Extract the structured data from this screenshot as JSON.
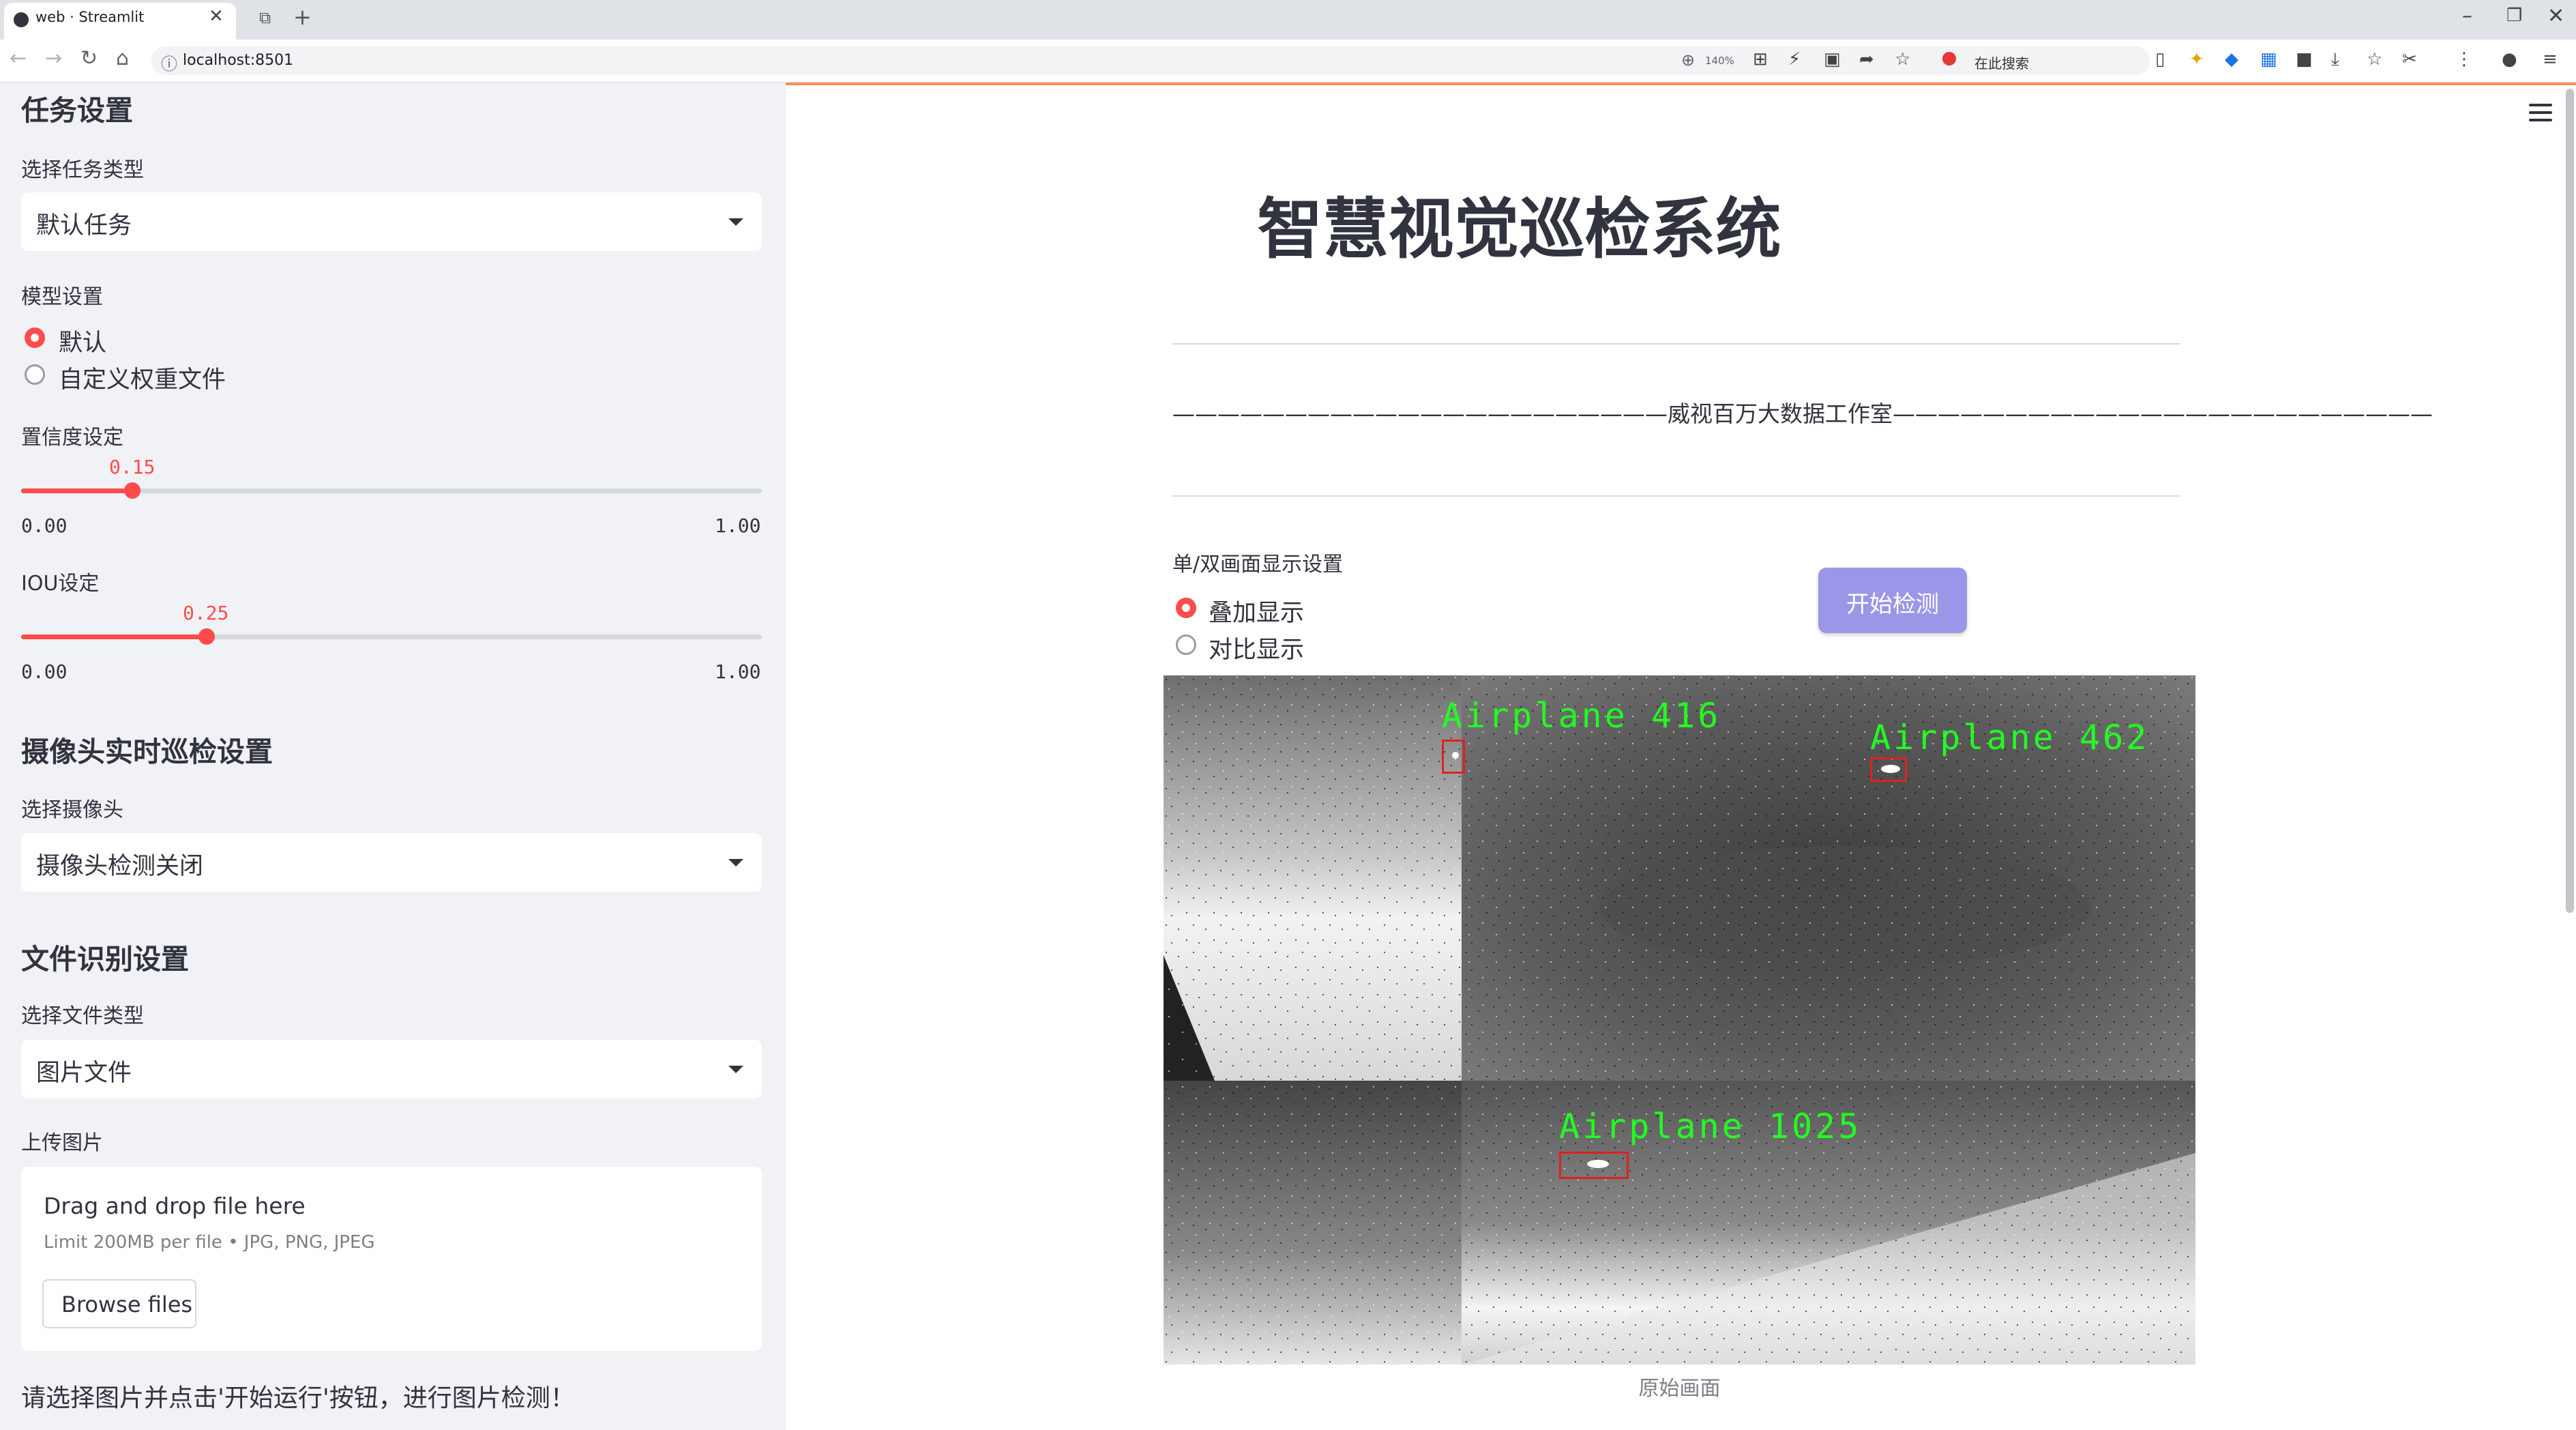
{
  "browser": {
    "tab_title": "web · Streamlit",
    "url": "localhost:8501",
    "zoom": "140%",
    "search_label": "在此搜索"
  },
  "sidebar": {
    "task_section_title": "任务设置",
    "task_type_label": "选择任务类型",
    "task_type_value": "默认任务",
    "model_label": "模型设置",
    "model_options": [
      "默认",
      "自定义权重文件"
    ],
    "model_selected": "默认",
    "confidence": {
      "label": "置信度设定",
      "value": 0.15,
      "value_text": "0.15",
      "min_text": "0.00",
      "max_text": "1.00"
    },
    "iou": {
      "label": "IOU设定",
      "value": 0.25,
      "value_text": "0.25",
      "min_text": "0.00",
      "max_text": "1.00"
    },
    "camera_section_title": "摄像头实时巡检设置",
    "camera_label": "选择摄像头",
    "camera_value": "摄像头检测关闭",
    "file_section_title": "文件识别设置",
    "file_type_label": "选择文件类型",
    "file_type_value": "图片文件",
    "upload_label": "上传图片",
    "upload_title": "Drag and drop file here",
    "upload_limit": "Limit 200MB per file • JPG, PNG, JPEG",
    "browse_label": "Browse files",
    "hint": "请选择图片并点击'开始运行'按钮，进行图片检测！"
  },
  "main": {
    "title": "智慧视觉巡检系统",
    "subtitle": "——————————————————————威视百万大数据工作室————————————————————————",
    "display_label": "单/双画面显示设置",
    "display_options": [
      "叠加显示",
      "对比显示"
    ],
    "display_selected": "叠加显示",
    "start_button": "开始检测",
    "caption": "原始画面",
    "detections": [
      {
        "label": "Airplane  416"
      },
      {
        "label": "Airplane  462"
      },
      {
        "label": "Airplane  1025"
      }
    ]
  },
  "colors": {
    "accent": "#ff4b4b",
    "button": "#9a97e8",
    "detection_text": "#22ff22",
    "detection_box": "#e02020"
  }
}
